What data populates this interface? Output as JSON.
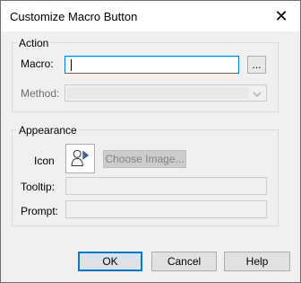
{
  "window": {
    "title": "Customize Macro Button"
  },
  "action": {
    "legend": "Action",
    "macro_label": "Macro:",
    "macro_value": "",
    "browse_label": "...",
    "method_label": "Method:",
    "method_value": ""
  },
  "appearance": {
    "legend": "Appearance",
    "icon_label": "Icon",
    "choose_image_label": "Choose Image...",
    "tooltip_label": "Tooltip:",
    "tooltip_value": "",
    "prompt_label": "Prompt:",
    "prompt_value": ""
  },
  "buttons": {
    "ok": "OK",
    "cancel": "Cancel",
    "help": "Help"
  },
  "colors": {
    "accent": "#0078d7",
    "face": "#f0f0f0"
  }
}
